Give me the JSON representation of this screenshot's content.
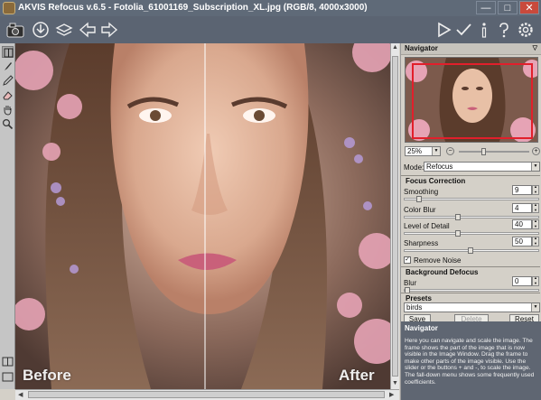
{
  "window": {
    "title": "AKVIS Refocus v.6.5 - Fotolia_61001169_Subscription_XL.jpg (RGB/8, 4000x3000)",
    "controls": {
      "minimize": "—",
      "maximize": "□",
      "close": "✕"
    }
  },
  "toolbar": {
    "left": [
      "camera-icon",
      "download-icon",
      "batch-icon",
      "back-arrow-icon",
      "forward-arrow-icon"
    ],
    "right": [
      "run-icon",
      "apply-icon",
      "info-icon",
      "help-icon",
      "settings-icon"
    ]
  },
  "tools": [
    "preview-window-icon",
    "brush-icon",
    "pencil-icon",
    "eraser-icon",
    "hand-icon",
    "zoom-icon"
  ],
  "canvas": {
    "before_label": "Before",
    "after_label": "After"
  },
  "navigator": {
    "title": "Navigator",
    "zoom": "25%"
  },
  "settings": {
    "mode_label": "Mode:",
    "mode_value": "Refocus",
    "focus_correction": "Focus Correction",
    "smoothing": {
      "label": "Smoothing",
      "value": "9",
      "level": 0.09
    },
    "color_blur": {
      "label": "Color Blur",
      "value": "4",
      "level": 0.4
    },
    "level_of_detail": {
      "label": "Level of Detail",
      "value": "40",
      "level": 0.4
    },
    "sharpness": {
      "label": "Sharpness",
      "value": "50",
      "level": 0.5
    },
    "remove_noise": {
      "label": "Remove Noise",
      "checked": true
    },
    "background_defocus": "Background Defocus",
    "blur": {
      "label": "Blur",
      "value": "0",
      "level": 0.0
    }
  },
  "presets": {
    "title": "Presets",
    "value": "birds",
    "save": "Save",
    "delete": "Delete",
    "reset": "Reset"
  },
  "help": {
    "title": "Navigator",
    "body": "Here you can navigate and scale the image. The frame shows the part of the image that is now visible in the Image Window. Drag the frame to make other parts of the image visible. Use the slider or the buttons + and -, to scale the image. The fall-down menu shows some frequently used coefficients."
  }
}
